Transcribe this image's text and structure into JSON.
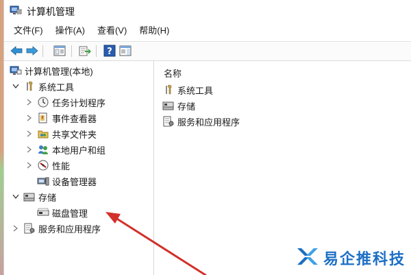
{
  "window": {
    "title": "计算机管理"
  },
  "menu": [
    {
      "label": "文件(F)"
    },
    {
      "label": "操作(A)"
    },
    {
      "label": "查看(V)"
    },
    {
      "label": "帮助(H)"
    }
  ],
  "toolbar": {
    "buttons": [
      "back-arrow-icon",
      "forward-arrow-icon",
      "console-tree-icon",
      "export-list-icon",
      "help-icon",
      "show-hide-pane-icon"
    ]
  },
  "tree": {
    "root": {
      "label": "计算机管理(本地)"
    },
    "system_tools": {
      "label": "系统工具",
      "children": [
        {
          "label": "任务计划程序"
        },
        {
          "label": "事件查看器"
        },
        {
          "label": "共享文件夹"
        },
        {
          "label": "本地用户和组"
        },
        {
          "label": "性能"
        },
        {
          "label": "设备管理器"
        }
      ]
    },
    "storage": {
      "label": "存储",
      "children": [
        {
          "label": "磁盘管理"
        }
      ]
    },
    "services": {
      "label": "服务和应用程序"
    }
  },
  "detail": {
    "column_header": "名称",
    "items": [
      {
        "label": "系统工具"
      },
      {
        "label": "存储"
      },
      {
        "label": "服务和应用程序"
      }
    ]
  },
  "annotation": {
    "arrow_color": "#d2302a"
  },
  "watermark": {
    "text": "易企推科技"
  },
  "colors": {
    "accent": "#1c6fc4",
    "arrow": "#d2302a"
  }
}
